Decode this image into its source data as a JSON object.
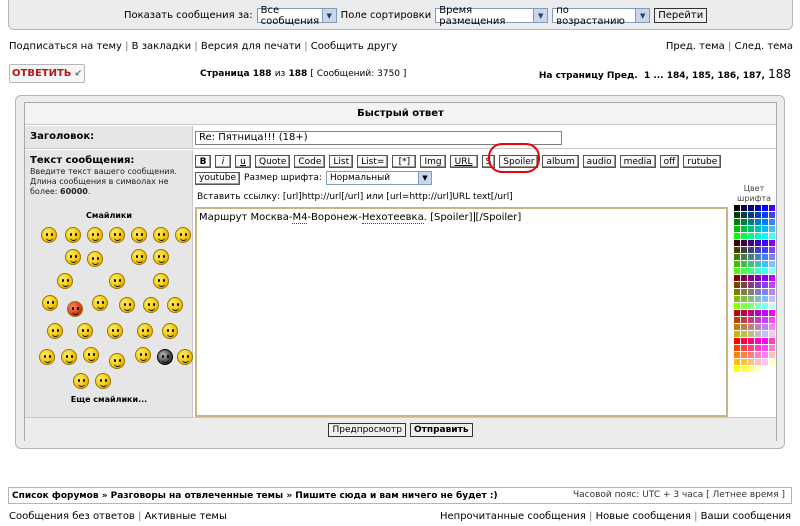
{
  "sortbar": {
    "show_label": "Показать сообщения за:",
    "show_value": "Все сообщения",
    "sort_label": "Поле сортировки",
    "sort_value": "Время размещения",
    "order_value": "по возрастанию",
    "go_label": "Перейти"
  },
  "toplinks": [
    "Подписаться на тему",
    "В закладки",
    "Версия для печати",
    "Сообщить другу"
  ],
  "navlinks": [
    "Пред. тема",
    "След. тема"
  ],
  "reply_button": "ОТВЕТИТЬ",
  "page_info": {
    "prefix": "Страница",
    "current": "188",
    "of": "из",
    "total": "188",
    "messages": "[ Сообщений: 3750 ]"
  },
  "page_nav": {
    "label": "На страницу",
    "prev": "Пред.",
    "pages": "1 ... 184, 185, 186, 187,",
    "current": "188"
  },
  "quick_reply": {
    "title": "Быстрый ответ",
    "subject_label": "Заголовок:",
    "subject_value": "Re: Пятница!!! (18+)",
    "message_label": "Текст сообщения:",
    "message_desc": "Введите текст вашего сообщения. Длина сообщения в символах не более: ",
    "message_max": "60000",
    "smileys_title": "Смайлики",
    "more_smileys": "Еще смайлики...",
    "bbcodes_row1": [
      "B",
      "i",
      "u",
      "Quote",
      "Code",
      "List",
      "List=",
      "[*]",
      "Img",
      "URL",
      "S",
      "Spoiler",
      "album",
      "audio",
      "media",
      "off",
      "rutube"
    ],
    "bbcode_youtube": "youtube",
    "font_size_label": "Размер шрифта:",
    "font_size_value": "Нормальный",
    "hint": "Вставить ссылку: [url]http://url[/url] или [url=http://url]URL text[/url]",
    "text_before": "Маршрут Москва-",
    "text_m4": "М4",
    "text_mid": "-Воронеж-",
    "text_nekh": "Нехотеевка",
    "text_after": ". [Spoiler]",
    "text_end": "[/Spoiler]",
    "color_label": "Цвет шрифта",
    "preview_button": "Предпросмотр",
    "submit_button": "Отправить"
  },
  "breadcrumb": {
    "forums": "Список форумов",
    "sep": "»",
    "section": "Разговоры на отвлеченные темы",
    "topic": "Пишите сюда и вам ничего не будет :)",
    "timezone": "Часовой пояс: UTC + 3 часа",
    "dst": "[ Летнее время ]"
  },
  "bottom_left": [
    "Сообщения без ответов",
    "Активные темы"
  ],
  "bottom_right": [
    "Непрочитанные сообщения",
    "Новые сообщения",
    "Ваши сообщения"
  ],
  "palette_colors": [
    "#000000",
    "#000040",
    "#000080",
    "#0000bf",
    "#0000ff",
    "#4000ff",
    "#004000",
    "#004040",
    "#004080",
    "#0040bf",
    "#0040ff",
    "#4040ff",
    "#008000",
    "#008040",
    "#008080",
    "#0080bf",
    "#0080ff",
    "#4080ff",
    "#00bf00",
    "#00bf40",
    "#00bf80",
    "#00bfbf",
    "#00bfff",
    "#40bfff",
    "#00ff00",
    "#00ff40",
    "#00ff80",
    "#00ffbf",
    "#00ffff",
    "#40ffff",
    "#400000",
    "#400040",
    "#400080",
    "#4000bf",
    "#4000ff",
    "#8000ff",
    "#404000",
    "#404040",
    "#404080",
    "#4040bf",
    "#4040ff",
    "#8040ff",
    "#408000",
    "#408040",
    "#408080",
    "#4080bf",
    "#4080ff",
    "#8080ff",
    "#40bf00",
    "#40bf40",
    "#40bf80",
    "#40bfbf",
    "#40bfff",
    "#80bfff",
    "#40ff00",
    "#40ff40",
    "#40ff80",
    "#40ffbf",
    "#40ffff",
    "#80ffff",
    "#800000",
    "#800040",
    "#800080",
    "#8000bf",
    "#8000ff",
    "#bf00ff",
    "#804000",
    "#804040",
    "#804080",
    "#8040bf",
    "#8040ff",
    "#bf40ff",
    "#808000",
    "#808040",
    "#808080",
    "#8080bf",
    "#8080ff",
    "#bf80ff",
    "#80bf00",
    "#80bf40",
    "#80bf80",
    "#80bfbf",
    "#80bfff",
    "#bfbfff",
    "#80ff00",
    "#80ff40",
    "#80ff80",
    "#80ffbf",
    "#80ffff",
    "#bfffff",
    "#bf0000",
    "#bf0040",
    "#bf0080",
    "#bf00bf",
    "#bf00ff",
    "#ff00ff",
    "#bf4000",
    "#bf4040",
    "#bf4080",
    "#bf40bf",
    "#bf40ff",
    "#ff40ff",
    "#bf8000",
    "#bf8040",
    "#bf8080",
    "#bf80bf",
    "#bf80ff",
    "#ff80ff",
    "#bfbf00",
    "#bfbf40",
    "#bfbf80",
    "#bfbfbf",
    "#bfbfff",
    "#ffbfff",
    "#ff0000",
    "#ff0040",
    "#ff0080",
    "#ff00bf",
    "#ff00ff",
    "#ff40bf",
    "#ff4000",
    "#ff4040",
    "#ff4080",
    "#ff40bf",
    "#ff40ff",
    "#ff80bf",
    "#ff8000",
    "#ff8040",
    "#ff8080",
    "#ff80bf",
    "#ff80ff",
    "#ffbfbf",
    "#ffbf00",
    "#ffbf40",
    "#ffbf80",
    "#ffbfbf",
    "#ffbfff",
    "#ffffbf",
    "#ffff00",
    "#ffff40",
    "#ffff80",
    "#ffffbf",
    "#ffffff",
    "#ffffff"
  ]
}
